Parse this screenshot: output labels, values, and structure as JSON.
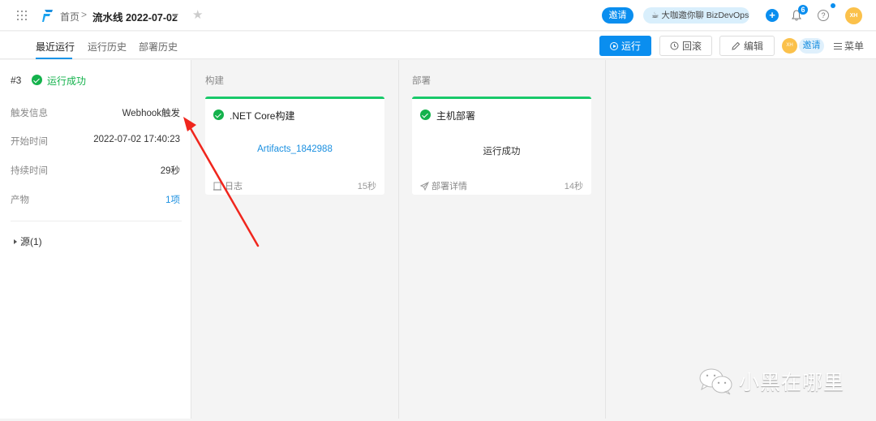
{
  "header": {
    "breadcrumb_home": "首页",
    "breadcrumb_sep": ">",
    "pipeline_title": "流水线 2022-07-02",
    "invite_label": "邀请",
    "promo_label": "☕ 大咖邀你聊 BizDevOps",
    "plus_label": "+",
    "notification_count": "6",
    "help_label": "?",
    "avatar_initials": "XH"
  },
  "tabs": [
    {
      "label": "最近运行",
      "active": true
    },
    {
      "label": "运行历史",
      "active": false
    },
    {
      "label": "部署历史",
      "active": false
    }
  ],
  "toolbar": {
    "run_label": "运行",
    "rollback_label": "回滚",
    "edit_label": "编辑",
    "member_initials": "XH",
    "invite_label": "邀请",
    "menu_label": "菜单"
  },
  "run_summary": {
    "run_number": "#3",
    "status": "运行成功",
    "fields": [
      {
        "label": "触发信息",
        "value": "Webhook触发",
        "link": false
      },
      {
        "label": "开始时间",
        "value": "2022-07-02 17:40:23",
        "link": false
      },
      {
        "label": "持续时间",
        "value": "29秒",
        "link": false
      },
      {
        "label": "产物",
        "value": "1项",
        "link": true
      }
    ],
    "source_toggle": "源(1)"
  },
  "stages": [
    {
      "title": "构建",
      "job": {
        "name": ".NET Core构建",
        "detail": "Artifacts_1842988",
        "footer_action": "日志",
        "duration": "15秒"
      }
    },
    {
      "title": "部署",
      "job": {
        "name": "主机部署",
        "detail": "运行成功",
        "footer_action": "部署详情",
        "duration": "14秒"
      }
    }
  ],
  "watermark": "小黑在哪里",
  "colors": {
    "primary": "#0a8eef",
    "success": "#14b24c",
    "stage_bar": "#19c96a",
    "avatar": "#fbc14b",
    "annotation_arrow": "#f0261d"
  }
}
